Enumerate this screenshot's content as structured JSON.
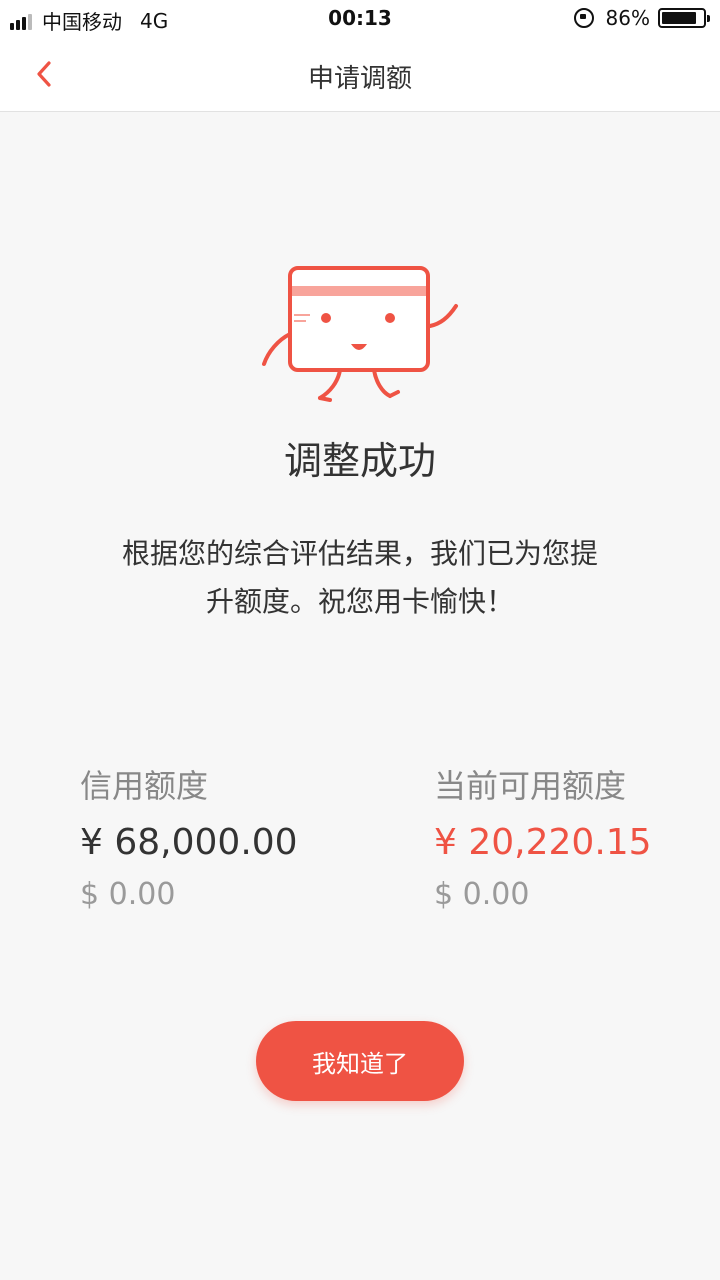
{
  "status_bar": {
    "carrier": "中国移动",
    "network": "4G",
    "time": "00:13",
    "battery_percent_text": "86%",
    "battery_level": 0.86,
    "signal_bars": 3
  },
  "nav": {
    "back_icon": "chevron-left-icon",
    "title": "申请调额"
  },
  "result": {
    "mascot_icon": "credit-card-mascot-icon",
    "title": "调整成功",
    "description_line1": "根据您的综合评估结果，我们已为您提",
    "description_line2": "升额度。祝您用卡愉快！"
  },
  "limits": {
    "credit_label": "信用额度",
    "credit_amount": "¥ 68,000.00",
    "credit_usd": "$ 0.00",
    "available_label": "当前可用额度",
    "available_amount": "¥ 20,220.15",
    "available_usd": "$ 0.00"
  },
  "actions": {
    "confirm_label": "我知道了"
  },
  "colors": {
    "accent": "#ef5344",
    "mascot_stripe": "#f8a49b",
    "background": "#f7f7f7"
  }
}
